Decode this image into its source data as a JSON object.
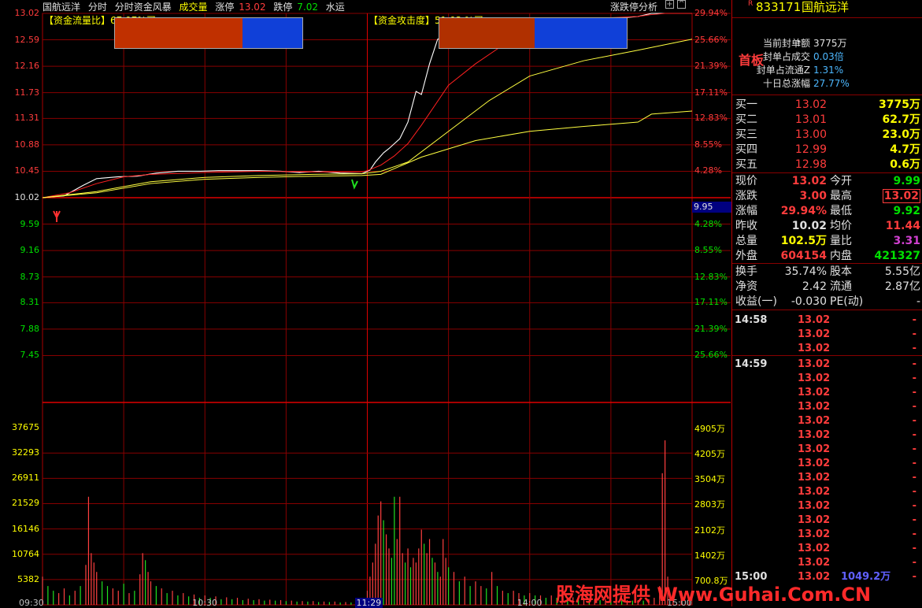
{
  "topbar": {
    "stock": "国航远洋",
    "menu": [
      "分时",
      "分时资金风暴",
      "成交量"
    ],
    "limit_up_label": "涨停",
    "limit_up_value": "13.02",
    "limit_down_label": "跌停",
    "limit_down_value": "7.02",
    "industry": "水运",
    "analysis": "涨跌停分析"
  },
  "indicators": {
    "flow_label": "【资金流量比】",
    "flow_value": "67.97%买",
    "attack_label": "【资金攻击度】",
    "attack_value": "51.03 %买"
  },
  "price_axis": [
    "13.02",
    "12.59",
    "12.16",
    "11.73",
    "11.31",
    "10.88",
    "10.45",
    "10.02",
    "9.59",
    "9.16",
    "8.73",
    "8.31",
    "7.88",
    "7.45"
  ],
  "pct_axis": [
    "29.94%",
    "25.66%",
    "21.39%",
    "17.11%",
    "12.83%",
    "8.55%",
    "4.28%",
    "",
    "4.28%",
    "8.55%",
    "12.83%",
    "17.11%",
    "21.39%",
    "25.66%"
  ],
  "cursor_price": "9.95",
  "vol_axis_left": [
    "37675",
    "32293",
    "26911",
    "21529",
    "16146",
    "10764",
    "5382"
  ],
  "vol_axis_right": [
    "4905万",
    "4205万",
    "3504万",
    "2803万",
    "2102万",
    "1402万",
    "700.8万"
  ],
  "time_axis": [
    "09:30",
    "10:30",
    "11:29",
    "14:00",
    "15:00"
  ],
  "chart_data": {
    "type": "line",
    "xlabel": "",
    "ylabel": "",
    "prev_close": 10.02,
    "ylim": [
      7.02,
      13.02
    ],
    "series": [
      {
        "x": [
          0,
          8,
          15,
          20,
          28,
          35,
          42,
          50,
          58,
          65,
          72,
          80,
          88,
          95,
          102,
          110,
          118,
          120,
          121,
          123,
          126,
          128,
          130,
          132,
          135,
          138,
          140,
          143,
          146,
          150,
          155,
          160,
          165,
          170,
          175,
          180,
          185,
          190,
          200,
          205,
          210,
          215,
          220,
          225,
          229,
          235,
          240
        ],
        "values": [
          10.02,
          10.05,
          10.22,
          10.33,
          10.36,
          10.37,
          10.42,
          10.45,
          10.45,
          10.46,
          10.46,
          10.46,
          10.45,
          10.43,
          10.45,
          10.42,
          10.41,
          10.45,
          10.47,
          10.6,
          10.75,
          10.82,
          10.9,
          10.98,
          11.25,
          11.75,
          11.7,
          12.2,
          12.6,
          12.65,
          12.8,
          12.72,
          12.85,
          12.84,
          12.88,
          12.87,
          12.85,
          12.88,
          12.86,
          12.9,
          12.92,
          12.95,
          12.97,
          13.02,
          13.02,
          13.02,
          13.02
        ]
      },
      {
        "x": [
          0,
          10,
          20,
          30,
          40,
          60,
          80,
          100,
          118,
          120,
          125,
          130,
          135,
          140,
          150,
          160,
          170,
          180,
          190,
          200,
          210,
          220,
          225,
          230,
          240
        ],
        "values": [
          10.02,
          10.1,
          10.25,
          10.36,
          10.4,
          10.43,
          10.45,
          10.44,
          10.44,
          10.46,
          10.55,
          10.7,
          10.9,
          11.2,
          11.85,
          12.2,
          12.5,
          12.7,
          12.85,
          12.9,
          12.95,
          12.97,
          13.0,
          13.02,
          13.02
        ]
      },
      {
        "x": [
          0,
          20,
          40,
          60,
          80,
          100,
          118,
          125,
          135,
          150,
          165,
          180,
          200,
          220,
          240
        ],
        "values": [
          10.02,
          10.12,
          10.28,
          10.35,
          10.38,
          10.4,
          10.41,
          10.45,
          10.6,
          11.1,
          11.6,
          12.0,
          12.25,
          12.42,
          12.6
        ]
      },
      {
        "x": [
          0,
          20,
          40,
          60,
          80,
          100,
          118,
          125,
          140,
          160,
          180,
          200,
          220,
          225,
          240
        ],
        "values": [
          10.02,
          10.1,
          10.25,
          10.32,
          10.35,
          10.37,
          10.38,
          10.4,
          10.68,
          10.95,
          11.1,
          11.18,
          11.25,
          11.38,
          11.43
        ]
      }
    ],
    "volume": {
      "ylim": [
        0,
        43057
      ],
      "bars": [
        {
          "x": 0,
          "v": 6000,
          "c": "r"
        },
        {
          "x": 2,
          "v": 4000,
          "c": "g"
        },
        {
          "x": 4,
          "v": 3000,
          "c": "g"
        },
        {
          "x": 6,
          "v": 2500,
          "c": "r"
        },
        {
          "x": 8,
          "v": 3500,
          "c": "r"
        },
        {
          "x": 10,
          "v": 2000,
          "c": "g"
        },
        {
          "x": 12,
          "v": 3000,
          "c": "r"
        },
        {
          "x": 14,
          "v": 4000,
          "c": "g"
        },
        {
          "x": 16,
          "v": 8500,
          "c": "r"
        },
        {
          "x": 17,
          "v": 23000,
          "c": "r"
        },
        {
          "x": 18,
          "v": 11000,
          "c": "r"
        },
        {
          "x": 19,
          "v": 9000,
          "c": "r"
        },
        {
          "x": 20,
          "v": 7000,
          "c": "r"
        },
        {
          "x": 22,
          "v": 5000,
          "c": "g"
        },
        {
          "x": 24,
          "v": 4000,
          "c": "g"
        },
        {
          "x": 26,
          "v": 3500,
          "c": "r"
        },
        {
          "x": 28,
          "v": 3000,
          "c": "r"
        },
        {
          "x": 30,
          "v": 4500,
          "c": "g"
        },
        {
          "x": 32,
          "v": 2500,
          "c": "r"
        },
        {
          "x": 34,
          "v": 3000,
          "c": "g"
        },
        {
          "x": 36,
          "v": 6500,
          "c": "r"
        },
        {
          "x": 37,
          "v": 11000,
          "c": "r"
        },
        {
          "x": 38,
          "v": 9500,
          "c": "g"
        },
        {
          "x": 39,
          "v": 7000,
          "c": "r"
        },
        {
          "x": 40,
          "v": 5000,
          "c": "r"
        },
        {
          "x": 42,
          "v": 4000,
          "c": "g"
        },
        {
          "x": 44,
          "v": 3500,
          "c": "r"
        },
        {
          "x": 46,
          "v": 2500,
          "c": "g"
        },
        {
          "x": 48,
          "v": 3000,
          "c": "r"
        },
        {
          "x": 50,
          "v": 2000,
          "c": "g"
        },
        {
          "x": 52,
          "v": 2500,
          "c": "r"
        },
        {
          "x": 54,
          "v": 1800,
          "c": "g"
        },
        {
          "x": 56,
          "v": 2200,
          "c": "r"
        },
        {
          "x": 58,
          "v": 1500,
          "c": "g"
        },
        {
          "x": 60,
          "v": 2000,
          "c": "r"
        },
        {
          "x": 62,
          "v": 1500,
          "c": "g"
        },
        {
          "x": 64,
          "v": 1800,
          "c": "r"
        },
        {
          "x": 66,
          "v": 1200,
          "c": "g"
        },
        {
          "x": 68,
          "v": 1600,
          "c": "r"
        },
        {
          "x": 70,
          "v": 1200,
          "c": "g"
        },
        {
          "x": 72,
          "v": 1500,
          "c": "r"
        },
        {
          "x": 74,
          "v": 1000,
          "c": "g"
        },
        {
          "x": 76,
          "v": 1300,
          "c": "r"
        },
        {
          "x": 78,
          "v": 1000,
          "c": "g"
        },
        {
          "x": 80,
          "v": 1200,
          "c": "r"
        },
        {
          "x": 82,
          "v": 900,
          "c": "g"
        },
        {
          "x": 84,
          "v": 1100,
          "c": "r"
        },
        {
          "x": 86,
          "v": 900,
          "c": "g"
        },
        {
          "x": 88,
          "v": 1000,
          "c": "r"
        },
        {
          "x": 90,
          "v": 800,
          "c": "g"
        },
        {
          "x": 92,
          "v": 900,
          "c": "r"
        },
        {
          "x": 94,
          "v": 700,
          "c": "g"
        },
        {
          "x": 96,
          "v": 800,
          "c": "r"
        },
        {
          "x": 98,
          "v": 700,
          "c": "g"
        },
        {
          "x": 100,
          "v": 800,
          "c": "r"
        },
        {
          "x": 102,
          "v": 600,
          "c": "g"
        },
        {
          "x": 104,
          "v": 700,
          "c": "r"
        },
        {
          "x": 106,
          "v": 600,
          "c": "g"
        },
        {
          "x": 108,
          "v": 700,
          "c": "r"
        },
        {
          "x": 110,
          "v": 500,
          "c": "g"
        },
        {
          "x": 112,
          "v": 600,
          "c": "r"
        },
        {
          "x": 114,
          "v": 500,
          "c": "g"
        },
        {
          "x": 116,
          "v": 600,
          "c": "r"
        },
        {
          "x": 118,
          "v": 1500,
          "c": "g"
        },
        {
          "x": 120,
          "v": 3000,
          "c": "r"
        },
        {
          "x": 121,
          "v": 6000,
          "c": "r"
        },
        {
          "x": 122,
          "v": 9000,
          "c": "r"
        },
        {
          "x": 123,
          "v": 13000,
          "c": "r"
        },
        {
          "x": 124,
          "v": 19000,
          "c": "r"
        },
        {
          "x": 125,
          "v": 22000,
          "c": "r"
        },
        {
          "x": 126,
          "v": 18000,
          "c": "g"
        },
        {
          "x": 127,
          "v": 15000,
          "c": "r"
        },
        {
          "x": 128,
          "v": 12000,
          "c": "r"
        },
        {
          "x": 129,
          "v": 10000,
          "c": "g"
        },
        {
          "x": 130,
          "v": 23000,
          "c": "g"
        },
        {
          "x": 131,
          "v": 14000,
          "c": "r"
        },
        {
          "x": 132,
          "v": 23000,
          "c": "r"
        },
        {
          "x": 133,
          "v": 11000,
          "c": "r"
        },
        {
          "x": 134,
          "v": 9000,
          "c": "g"
        },
        {
          "x": 135,
          "v": 12000,
          "c": "r"
        },
        {
          "x": 136,
          "v": 8000,
          "c": "g"
        },
        {
          "x": 137,
          "v": 10000,
          "c": "r"
        },
        {
          "x": 138,
          "v": 9000,
          "c": "r"
        },
        {
          "x": 139,
          "v": 12000,
          "c": "r"
        },
        {
          "x": 140,
          "v": 16000,
          "c": "r"
        },
        {
          "x": 141,
          "v": 13000,
          "c": "g"
        },
        {
          "x": 142,
          "v": 11000,
          "c": "r"
        },
        {
          "x": 143,
          "v": 14000,
          "c": "r"
        },
        {
          "x": 144,
          "v": 10000,
          "c": "g"
        },
        {
          "x": 145,
          "v": 9000,
          "c": "r"
        },
        {
          "x": 146,
          "v": 7000,
          "c": "g"
        },
        {
          "x": 147,
          "v": 6000,
          "c": "r"
        },
        {
          "x": 148,
          "v": 14000,
          "c": "r"
        },
        {
          "x": 149,
          "v": 10000,
          "c": "r"
        },
        {
          "x": 150,
          "v": 8000,
          "c": "g"
        },
        {
          "x": 152,
          "v": 7000,
          "c": "r"
        },
        {
          "x": 154,
          "v": 5000,
          "c": "g"
        },
        {
          "x": 156,
          "v": 6000,
          "c": "r"
        },
        {
          "x": 158,
          "v": 4000,
          "c": "g"
        },
        {
          "x": 160,
          "v": 5000,
          "c": "r"
        },
        {
          "x": 162,
          "v": 4000,
          "c": "r"
        },
        {
          "x": 164,
          "v": 3500,
          "c": "g"
        },
        {
          "x": 166,
          "v": 7000,
          "c": "r"
        },
        {
          "x": 168,
          "v": 4000,
          "c": "g"
        },
        {
          "x": 170,
          "v": 3000,
          "c": "r"
        },
        {
          "x": 172,
          "v": 2500,
          "c": "g"
        },
        {
          "x": 174,
          "v": 3000,
          "c": "r"
        },
        {
          "x": 176,
          "v": 2500,
          "c": "r"
        },
        {
          "x": 178,
          "v": 2000,
          "c": "g"
        },
        {
          "x": 180,
          "v": 2500,
          "c": "r"
        },
        {
          "x": 182,
          "v": 2000,
          "c": "g"
        },
        {
          "x": 184,
          "v": 2000,
          "c": "r"
        },
        {
          "x": 186,
          "v": 1500,
          "c": "g"
        },
        {
          "x": 188,
          "v": 2000,
          "c": "r"
        },
        {
          "x": 190,
          "v": 1500,
          "c": "g"
        },
        {
          "x": 192,
          "v": 1800,
          "c": "r"
        },
        {
          "x": 194,
          "v": 1500,
          "c": "g"
        },
        {
          "x": 196,
          "v": 1600,
          "c": "r"
        },
        {
          "x": 198,
          "v": 1200,
          "c": "g"
        },
        {
          "x": 200,
          "v": 1500,
          "c": "r"
        },
        {
          "x": 202,
          "v": 1200,
          "c": "g"
        },
        {
          "x": 204,
          "v": 1300,
          "c": "r"
        },
        {
          "x": 206,
          "v": 1000,
          "c": "g"
        },
        {
          "x": 208,
          "v": 1200,
          "c": "r"
        },
        {
          "x": 210,
          "v": 1000,
          "c": "g"
        },
        {
          "x": 212,
          "v": 1100,
          "c": "r"
        },
        {
          "x": 214,
          "v": 900,
          "c": "g"
        },
        {
          "x": 216,
          "v": 1000,
          "c": "r"
        },
        {
          "x": 218,
          "v": 900,
          "c": "g"
        },
        {
          "x": 220,
          "v": 1000,
          "c": "r"
        },
        {
          "x": 222,
          "v": 900,
          "c": "g"
        },
        {
          "x": 224,
          "v": 1200,
          "c": "r"
        },
        {
          "x": 226,
          "v": 1500,
          "c": "r"
        },
        {
          "x": 228,
          "v": 4000,
          "c": "r"
        },
        {
          "x": 229,
          "v": 28000,
          "c": "r"
        },
        {
          "x": 230,
          "v": 35000,
          "c": "r"
        },
        {
          "x": 231,
          "v": 6000,
          "c": "r"
        },
        {
          "x": 233,
          "v": 2000,
          "c": "r"
        },
        {
          "x": 236,
          "v": 1500,
          "c": "r"
        },
        {
          "x": 239,
          "v": 1000,
          "c": "r"
        }
      ]
    }
  },
  "right_panel": {
    "code": "833171",
    "name": "国航远洋",
    "badge": "首板",
    "seal_rows": [
      {
        "label": "当前封单额",
        "value": "3775万"
      },
      {
        "label": "封单占成交",
        "value": "0.03倍"
      },
      {
        "label": "封单占流通Z",
        "value": "1.31%"
      },
      {
        "label": "十日总涨幅",
        "value": "27.77%"
      }
    ],
    "book": [
      {
        "label": "买一",
        "price": "13.02",
        "vol": "3775万"
      },
      {
        "label": "买二",
        "price": "13.01",
        "vol": "62.7万"
      },
      {
        "label": "买三",
        "price": "13.00",
        "vol": "23.0万"
      },
      {
        "label": "买四",
        "price": "12.99",
        "vol": "4.7万"
      },
      {
        "label": "买五",
        "price": "12.98",
        "vol": "0.6万"
      }
    ],
    "stats": [
      {
        "l1": "现价",
        "v1": "13.02",
        "c1": "#ff3c3c",
        "l2": "今开",
        "v2": "9.99",
        "c2": "#00e000"
      },
      {
        "l1": "涨跌",
        "v1": "3.00",
        "c1": "#ff3c3c",
        "l2": "最高",
        "v2": "13.02",
        "c2": "#ff3c3c"
      },
      {
        "l1": "涨幅",
        "v1": "29.94%",
        "c1": "#ff3c3c",
        "l2": "最低",
        "v2": "9.92",
        "c2": "#00e000"
      },
      {
        "l1": "昨收",
        "v1": "10.02",
        "c1": "#e0e0e0",
        "l2": "均价",
        "v2": "11.44",
        "c2": "#ff3c3c"
      },
      {
        "l1": "总量",
        "v1": "102.5万",
        "c1": "#ffff00",
        "l2": "量比",
        "v2": "3.31",
        "c2": "#d040d0"
      },
      {
        "l1": "外盘",
        "v1": "604154",
        "c1": "#ff3c3c",
        "l2": "内盘",
        "v2": "421327",
        "c2": "#00e000"
      }
    ],
    "stats2": [
      {
        "l1": "换手",
        "v1": "35.74%",
        "l2": "股本",
        "v2": "5.55亿"
      },
      {
        "l1": "净资",
        "v1": "2.42",
        "l2": "流通",
        "v2": "2.87亿"
      },
      {
        "l1": "收益(一)",
        "v1": "-0.030",
        "l2": "PE(动)",
        "v2": "-"
      }
    ],
    "ticks": [
      {
        "time": "14:58",
        "price": "13.02"
      },
      {
        "time": "",
        "price": "13.02"
      },
      {
        "time": "",
        "price": "13.02"
      },
      {
        "time": "14:59",
        "price": "13.02"
      },
      {
        "time": "",
        "price": "13.02"
      },
      {
        "time": "",
        "price": "13.02"
      },
      {
        "time": "",
        "price": "13.02"
      },
      {
        "time": "",
        "price": "13.02"
      },
      {
        "time": "",
        "price": "13.02"
      },
      {
        "time": "",
        "price": "13.02"
      },
      {
        "time": "",
        "price": "13.02"
      },
      {
        "time": "",
        "price": "13.02"
      },
      {
        "time": "",
        "price": "13.02"
      },
      {
        "time": "",
        "price": "13.02"
      },
      {
        "time": "",
        "price": "13.02"
      },
      {
        "time": "",
        "price": "13.02"
      },
      {
        "time": "",
        "price": "13.02"
      },
      {
        "time": "",
        "price": "13.02"
      },
      {
        "time": "15:00",
        "price": "13.02"
      }
    ],
    "last_tick_vol": "1049.2万"
  },
  "watermark": "股海网提供 Www.Guhai.Com.CN"
}
